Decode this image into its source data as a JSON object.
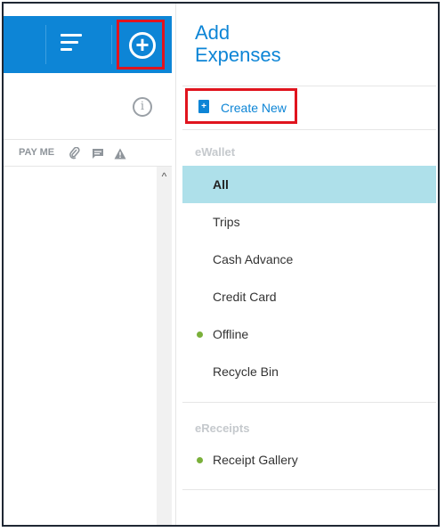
{
  "toolbar": {
    "sort_icon": "sort-lines-icon",
    "add_icon": "plus-circle-icon",
    "add_symbol": "+"
  },
  "left_panel": {
    "info_symbol": "i",
    "columns": {
      "pay_me": "PAY ME",
      "attachment_icon": "paperclip-icon",
      "comment_icon": "comment-icon",
      "warning_icon": "warning-icon"
    },
    "scroll_up": "^"
  },
  "right_panel": {
    "title_line1": "Add",
    "title_line2": "Expenses",
    "create_new": "Create New",
    "ewallet": {
      "label": "eWallet",
      "items": [
        {
          "label": "All",
          "active": true
        },
        {
          "label": "Trips"
        },
        {
          "label": "Cash Advance"
        },
        {
          "label": "Credit Card"
        },
        {
          "label": "Offline",
          "status_dot": true
        },
        {
          "label": "Recycle Bin"
        }
      ]
    },
    "ereceipts": {
      "label": "eReceipts",
      "items": [
        {
          "label": "Receipt Gallery",
          "status_dot": true
        }
      ]
    }
  },
  "colors": {
    "brand_blue": "#0d85d6",
    "highlight_red": "#e0141e",
    "active_row": "#aee0ea",
    "status_green": "#7ab03a"
  }
}
